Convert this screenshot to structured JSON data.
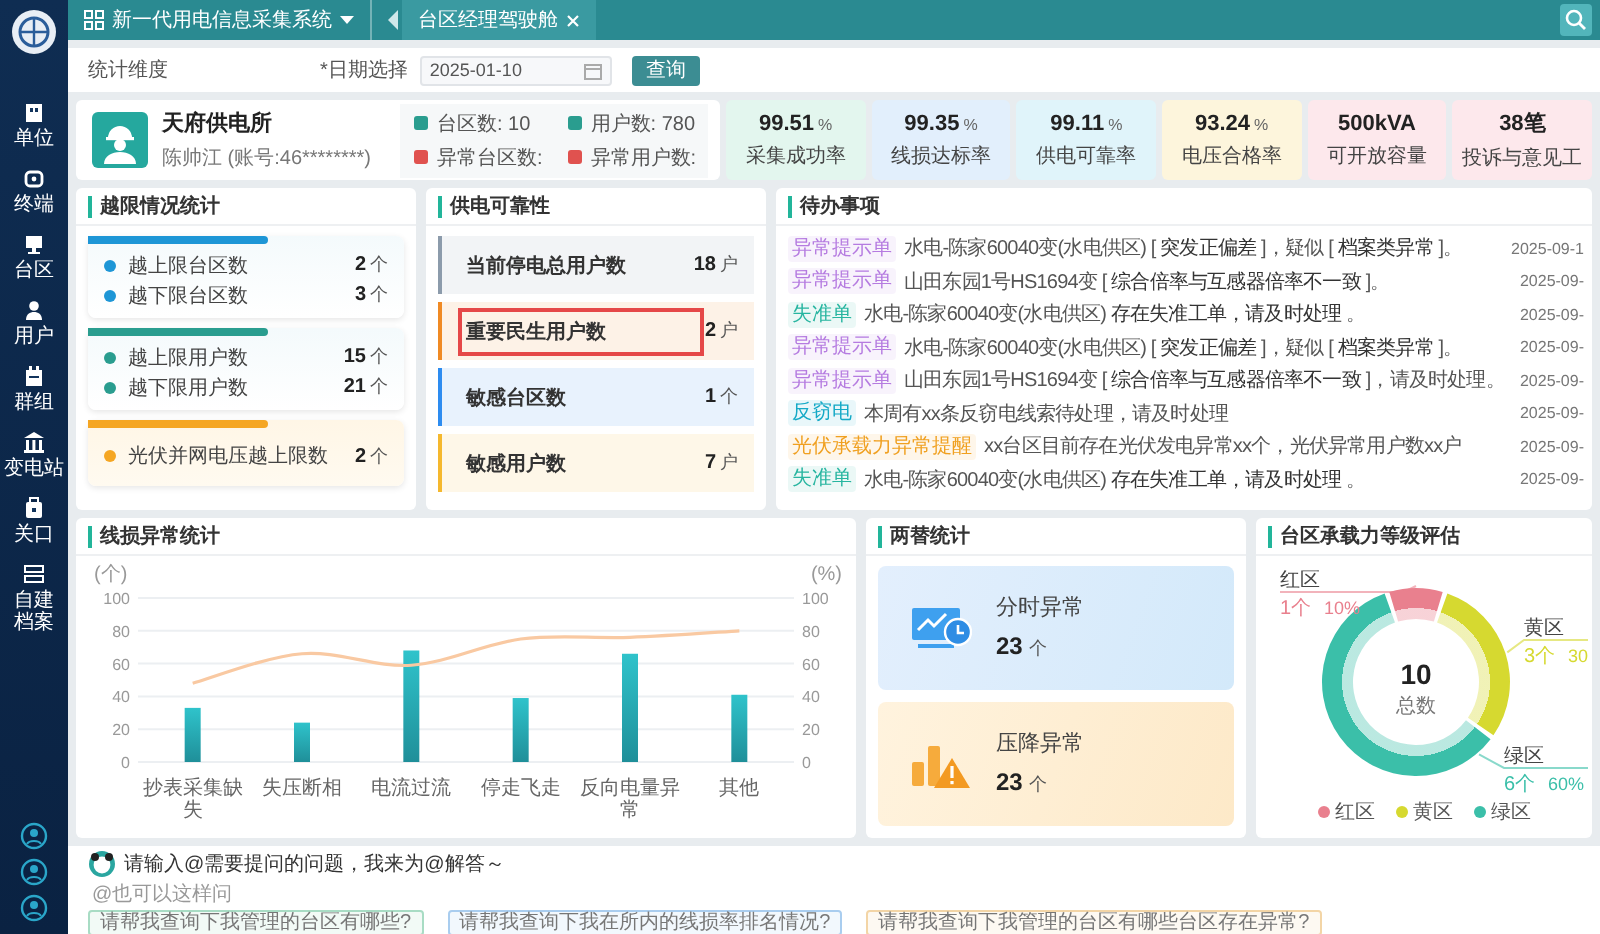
{
  "sidebar": {
    "items": [
      {
        "label": "单位"
      },
      {
        "label": "终端"
      },
      {
        "label": "台区"
      },
      {
        "label": "用户"
      },
      {
        "label": "群组"
      },
      {
        "label": "变电站"
      },
      {
        "label": "关口"
      },
      {
        "label": "自建档案"
      }
    ]
  },
  "topbar": {
    "system": "新一代用电信息采集系统",
    "tabs": [
      {
        "label": "台区经理驾驶舱",
        "selected": true
      }
    ]
  },
  "filter": {
    "dimension_label": "统计维度",
    "date_label": "*日期选择",
    "date_value": "2025-01-10",
    "query_button": "查询"
  },
  "profile": {
    "org": "天府供电所",
    "user": "陈帅江 (账号:46********)",
    "stats": [
      {
        "label": "台区数:",
        "value": "10",
        "color": "#2a9d8f"
      },
      {
        "label": "用户数:",
        "value": "780",
        "color": "#2a9d8f"
      },
      {
        "label": "异常台区数:",
        "color": "#e0524f"
      },
      {
        "label": "异常用户数:",
        "color": "#e0524f"
      }
    ]
  },
  "kpis": [
    {
      "value": "99.51",
      "unit": "%",
      "label": "采集成功率",
      "color": "#e3f6ee"
    },
    {
      "value": "99.35",
      "unit": "%",
      "label": "线损达标率",
      "color": "#e2effc"
    },
    {
      "value": "99.11",
      "unit": "%",
      "label": "供电可靠率",
      "color": "#e0f4fa"
    },
    {
      "value": "93.24",
      "unit": "%",
      "label": "电压合格率",
      "color": "#fdf5dc"
    },
    {
      "value": "500kVA",
      "label": "可开放容量",
      "color": "#fde8ec"
    },
    {
      "value": "38笔",
      "label": "投诉与意见工",
      "color": "#fde8ec"
    }
  ],
  "limit_stats": {
    "title": "越限情况统计",
    "groups": [
      {
        "color": "#1e96d6",
        "rows": [
          {
            "label": "越上限台区数",
            "value": "2",
            "unit": "个"
          },
          {
            "label": "越下限台区数",
            "value": "3",
            "unit": "个"
          }
        ]
      },
      {
        "color": "#2a9d8f",
        "rows": [
          {
            "label": "越上限用户数",
            "value": "15",
            "unit": "个"
          },
          {
            "label": "越下限用户数",
            "value": "21",
            "unit": "个"
          }
        ]
      },
      {
        "color": "#f5a623",
        "rows": [
          {
            "label": "光伏并网电压越上限数",
            "value": "2",
            "unit": "个"
          }
        ]
      }
    ]
  },
  "reliability": {
    "title": "供电可靠性",
    "rows": [
      {
        "label": "当前停电总用户数",
        "value": "18",
        "unit": "户",
        "color": "#8c9bab",
        "highlighted": false
      },
      {
        "label": "重要民生用户数",
        "value": "2",
        "unit": "户",
        "color": "#f08a24",
        "highlighted": true
      },
      {
        "label": "敏感台区数",
        "value": "1",
        "unit": "个",
        "color": "#2d8cf0",
        "highlighted": false
      },
      {
        "label": "敏感用户数",
        "value": "7",
        "unit": "户",
        "color": "#f5b82e",
        "highlighted": false
      }
    ]
  },
  "todo": {
    "title": "待办事项",
    "items": [
      {
        "tag": "异常提示单",
        "color": "#b57be0",
        "text": "水电-陈家60040变(水电供区) [ **突发正偏差** ]，疑似 [ **档案类异常** ]。",
        "date": "2025-09-1"
      },
      {
        "tag": "异常提示单",
        "color": "#b57be0",
        "text": "山田东园1号HS1694变 [ **综合倍率与互感器倍率不一致** ]。",
        "date": "2025-09-"
      },
      {
        "tag": "失准单",
        "color": "#27b5a0",
        "text": "水电-陈家60040变(水电供区) **存在失准工单，请及时处理** 。",
        "date": "2025-09-"
      },
      {
        "tag": "异常提示单",
        "color": "#b57be0",
        "text": "水电-陈家60040变(水电供区) [ **突发正偏差** ]，疑似 [ **档案类异常** ]。",
        "date": "2025-09-"
      },
      {
        "tag": "异常提示单",
        "color": "#b57be0",
        "text": "山田东园1号HS1694变 [ **综合倍率与互感器倍率不一致** ]，请及时处理。",
        "date": "2025-09-"
      },
      {
        "tag": "反窃电",
        "color": "#14a9c6",
        "text": "本周有xx条反窃电线索待处理，请及时处理",
        "date": "2025-09-"
      },
      {
        "tag": "光伏承载力异常提醒",
        "color": "#f0a020",
        "text": "xx台区目前存在光伏发电异常xx个，光伏异常用户数xx户",
        "date": "2025-09-"
      },
      {
        "tag": "失准单",
        "color": "#27b5a0",
        "text": "水电-陈家60040变(水电供区) **存在失准工单，请及时处理** 。",
        "date": "2025-09-"
      }
    ]
  },
  "line_loss": {
    "title": "线损异常统计",
    "chart_data": {
      "type": "bar",
      "ylabel": "(个)",
      "y2label": "(%)",
      "categories": [
        "抄表采集缺失",
        "失压断相",
        "电流过流",
        "停走飞走",
        "反向电量异常",
        "其他"
      ],
      "series": [
        {
          "type": "bar",
          "color": "#2fc3cb",
          "values": [
            33,
            24,
            68,
            39,
            66,
            41
          ]
        },
        {
          "type": "line",
          "color": "#f9c9a2",
          "values": [
            48,
            66,
            59,
            75,
            76,
            80
          ]
        }
      ],
      "grid": true,
      "ylim": [
        0,
        100
      ],
      "yticks": [
        0,
        20,
        40,
        60,
        80,
        100
      ],
      "y2lim": [
        0,
        100
      ],
      "y2ticks": [
        0,
        20,
        40,
        60,
        80,
        100
      ]
    }
  },
  "twin_stats": {
    "title": "两替统计",
    "cards": [
      {
        "kind": "time",
        "label": "分时异常",
        "value": "23",
        "unit": "个"
      },
      {
        "kind": "voltage",
        "label": "压降异常",
        "value": "23",
        "unit": "个"
      }
    ]
  },
  "capacity": {
    "title": "台区承载力等级评估",
    "total": "10",
    "total_label": "总数",
    "chart_data": {
      "type": "donut",
      "categories": [
        "红区",
        "黄区",
        "绿区"
      ],
      "values": [
        10,
        30,
        60
      ]
    },
    "callouts": [
      {
        "count": "1个",
        "percent": "10%"
      },
      {
        "count": "3个",
        "percent": "30"
      },
      {
        "count": "6个",
        "percent": "60%"
      }
    ],
    "legend": [
      {
        "label": "红区",
        "color": "#e9808e"
      },
      {
        "label": "黄区",
        "color": "#d6d930"
      },
      {
        "label": "绿区",
        "color": "#3bbfa9"
      }
    ]
  },
  "chat": {
    "prompt": "请输入@需要提问的问题，我来为@解答～",
    "hint": "@也可以这样问",
    "suggestions": [
      {
        "text": "请帮我查询下我管理的台区有哪些?",
        "color": "#a8dcc4"
      },
      {
        "text": "请帮我查询下我在所内的线损率排名情况?",
        "color": "#a9cdef"
      },
      {
        "text": "请帮我查询下我管理的台区有哪些台区存在异常?",
        "color": "#f3d5a6"
      }
    ]
  }
}
